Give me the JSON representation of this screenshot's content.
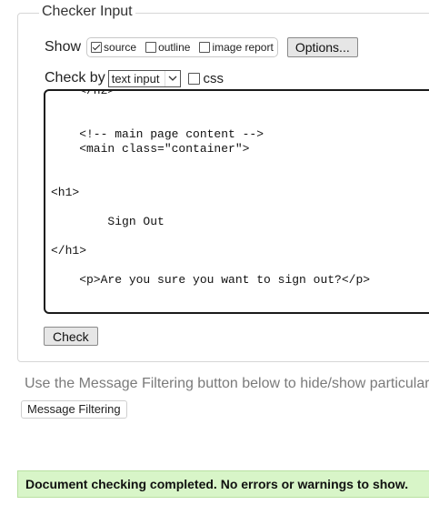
{
  "fieldset": {
    "legend": "Checker Input"
  },
  "show": {
    "label": "Show",
    "options": [
      {
        "label": "source",
        "checked": true
      },
      {
        "label": "outline",
        "checked": false
      },
      {
        "label": "image report",
        "checked": false
      }
    ],
    "options_button": "Options..."
  },
  "check_by": {
    "label": "Check by",
    "selected": "text input",
    "css_label": "css",
    "css_checked": false
  },
  "source_code": "    </h2>\n\n\n    <!-- main page content -->\n    <main class=\"container\">\n\n\n<h1>\n\n        Sign Out\n\n</h1>\n\n    <p>Are you sure you want to sign out?</p>\n",
  "check_button": "Check",
  "filter_hint": "Use the Message Filtering button below to hide/show particular",
  "filter_button": "Message Filtering",
  "status": {
    "text": "Document checking completed. No errors or warnings to show.",
    "color": "#d8f5c8"
  }
}
